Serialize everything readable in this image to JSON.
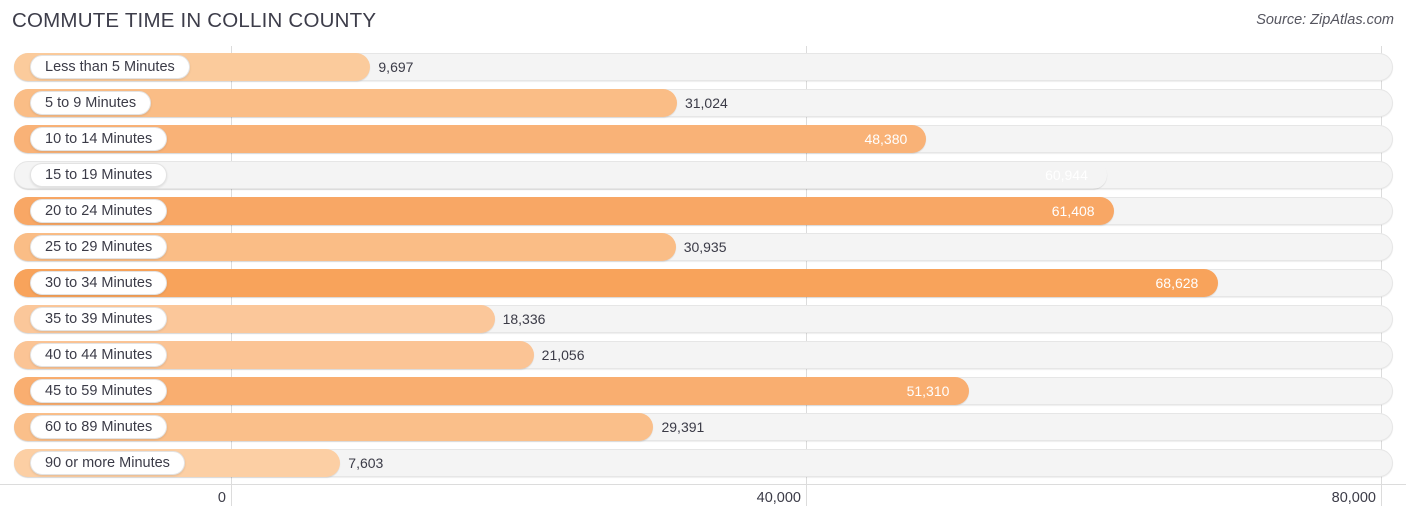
{
  "header": {
    "title": "COMMUTE TIME IN COLLIN COUNTY",
    "source": "Source: ZipAtlas.com"
  },
  "colors": {
    "bar_light": "#fbcb9c",
    "bar_mid": "#f9b378",
    "bar_dark": "#f9a busy",
    "bar_strong": "#f8a55c",
    "track": "#f4f4f4",
    "grid": "#dcdcdc",
    "text": "#3b3b47",
    "value_inside": "#ffffff"
  },
  "axis": {
    "min": 0,
    "max": 80000,
    "ticks": [
      {
        "value": 0,
        "label": "0"
      },
      {
        "value": 40000,
        "label": "40,000"
      },
      {
        "value": 80000,
        "label": "80,000"
      }
    ]
  },
  "chart_data": {
    "type": "bar",
    "orientation": "horizontal",
    "title": "COMMUTE TIME IN COLLIN COUNTY",
    "subtitle": "Source: ZipAtlas.com",
    "xlabel": "",
    "ylabel": "",
    "xlim": [
      0,
      80000
    ],
    "grid": true,
    "legend": "none",
    "categories": [
      "Less than 5 Minutes",
      "5 to 9 Minutes",
      "10 to 14 Minutes",
      "15 to 19 Minutes",
      "20 to 24 Minutes",
      "25 to 29 Minutes",
      "30 to 34 Minutes",
      "35 to 39 Minutes",
      "40 to 44 Minutes",
      "45 to 59 Minutes",
      "60 to 89 Minutes",
      "90 or more Minutes"
    ],
    "values": [
      9697,
      31024,
      48380,
      60944,
      61408,
      30935,
      68628,
      18336,
      21056,
      51310,
      29391,
      7603
    ],
    "value_labels": [
      "9,697",
      "31,024",
      "48,380",
      "60,944",
      "61,408",
      "30,935",
      "68,628",
      "18,336",
      "21,056",
      "51,310",
      "29,391",
      "7,603"
    ]
  },
  "rows": [
    {
      "label": "Less than 5 Minutes",
      "value": 9697,
      "value_label": "9,697",
      "color": "#fbcb9c",
      "label_inside": false
    },
    {
      "label": "5 to 9 Minutes",
      "value": 31024,
      "value_label": "31,024",
      "color": "#fabd86",
      "label_inside": false
    },
    {
      "label": "10 to 14 Minutes",
      "value": 48380,
      "value_label": "48,380",
      "color": "#f9b277",
      "label_inside": true
    },
    {
      "label": "15 to 19 Minutes",
      "value": 60944,
      "value_label": "60,944",
      "color": "#f9a a",
      "label_inside": true
    },
    {
      "label": "20 to 24 Minutes",
      "value": 61408,
      "value_label": "61,408",
      "color": "#f8a765",
      "label_inside": true
    },
    {
      "label": "25 to 29 Minutes",
      "value": 30935,
      "value_label": "30,935",
      "color": "#fabd86",
      "label_inside": false
    },
    {
      "label": "30 to 34 Minutes",
      "value": 68628,
      "value_label": "68,628",
      "color": "#f8a35b",
      "label_inside": true
    },
    {
      "label": "35 to 39 Minutes",
      "value": 18336,
      "value_label": "18,336",
      "color": "#fbc79a",
      "label_inside": false
    },
    {
      "label": "40 to 44 Minutes",
      "value": 21056,
      "value_label": "21,056",
      "color": "#fbc495",
      "label_inside": false
    },
    {
      "label": "45 to 59 Minutes",
      "value": 51310,
      "value_label": "51,310",
      "color": "#f9ae70",
      "label_inside": true
    },
    {
      "label": "60 to 89 Minutes",
      "value": 29391,
      "value_label": "29,391",
      "color": "#fabf8a",
      "label_inside": false
    },
    {
      "label": "90 or more Minutes",
      "value": 7603,
      "value_label": "7,603",
      "color": "#fccfa4",
      "label_inside": false
    }
  ]
}
